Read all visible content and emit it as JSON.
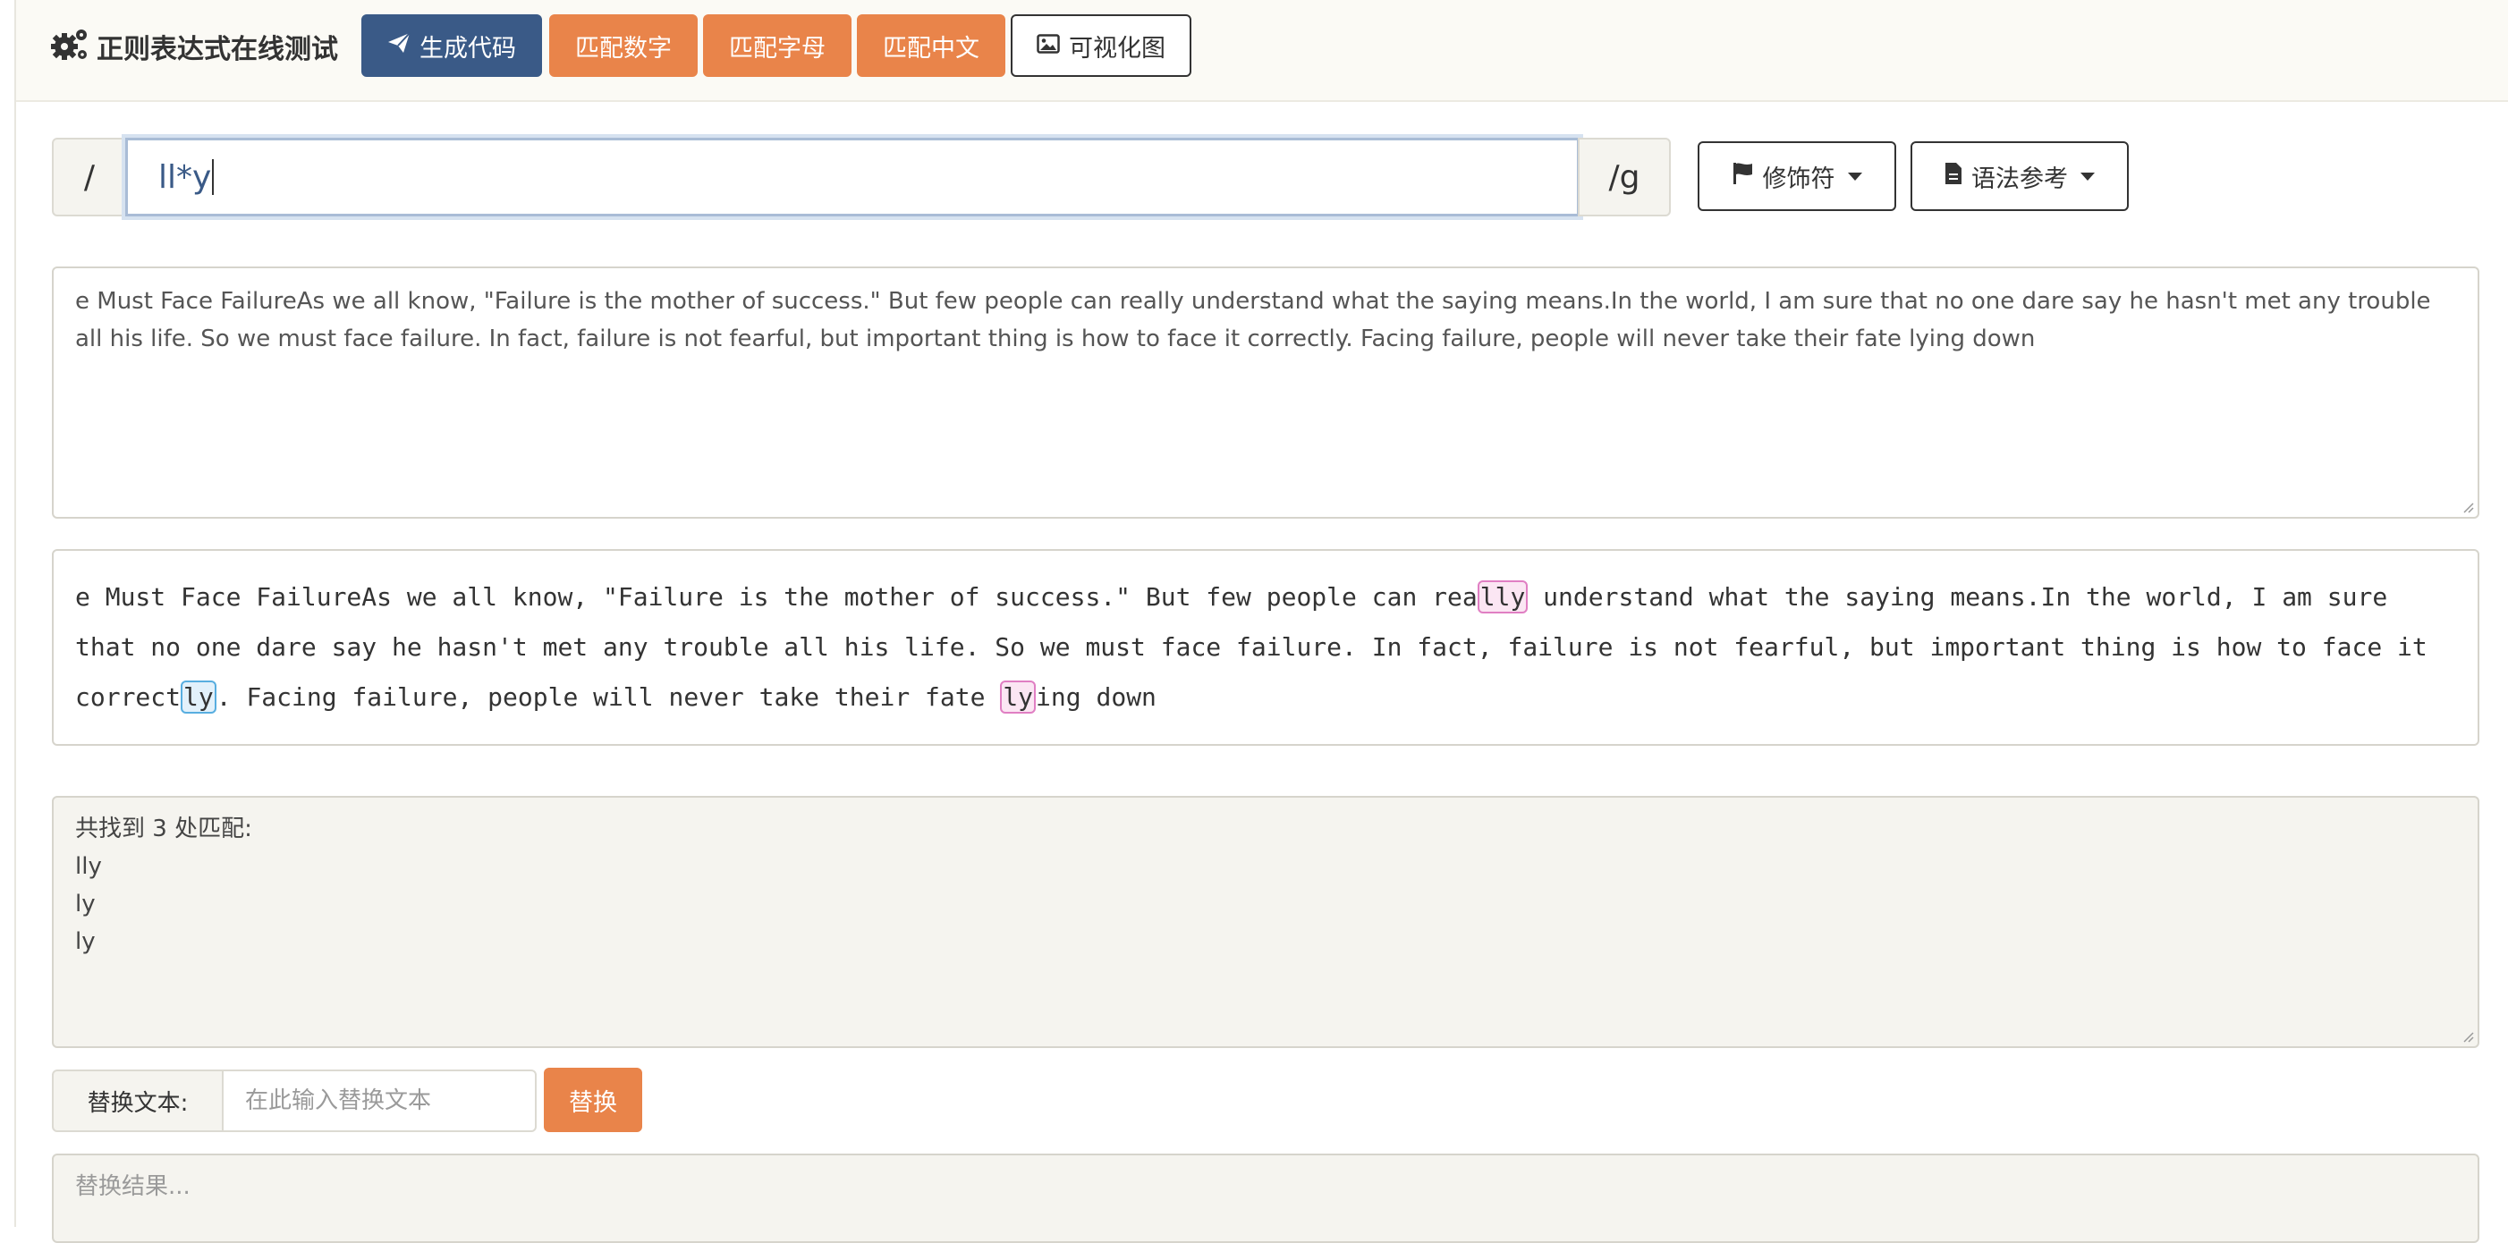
{
  "header": {
    "title": "正则表达式在线测试",
    "buttons": {
      "generate_code": "生成代码",
      "match_number": "匹配数字",
      "match_letter": "匹配字母",
      "match_chinese": "匹配中文",
      "visualize": "可视化图"
    }
  },
  "regex": {
    "open_delim": "/",
    "pattern": "ll*y",
    "close_delim": "/g",
    "modifier_label": "修饰符",
    "syntax_label": "语法参考"
  },
  "source_text": "e Must Face FailureAs we all know, \"Failure is the mother of success.\" But few people can really understand what the saying means.In the world, I am sure that no one dare say he hasn't met any trouble all his life. So we must face failure. In fact, failure is not fearful, but important thing is how to face it correctly. Facing failure, people will never take their fate lying down",
  "highlighted": {
    "seg1": "e Must Face FailureAs we all know, \"Failure is the mother of success.\" But few people can rea",
    "m1": "lly",
    "seg2": " understand what the saying means.In the world, I am sure that no one dare say he hasn't met any trouble all his life. So we must face failure. In fact, failure is not fearful, but important thing is how to face it correct",
    "m2": "ly",
    "seg3": ". Facing failure, people will never take their fate ",
    "m3": "ly",
    "seg4": "ing down"
  },
  "results": {
    "summary": "共找到 3 处匹配:",
    "matches": [
      "lly",
      "ly",
      "ly"
    ]
  },
  "replace": {
    "label": "替换文本:",
    "placeholder": "在此输入替换文本",
    "button": "替换",
    "result_placeholder": "替换结果..."
  },
  "colors": {
    "primary": "#3a5a87",
    "accent": "#e9844a",
    "match_pink": "#e07fc3",
    "match_blue": "#58aee0"
  }
}
